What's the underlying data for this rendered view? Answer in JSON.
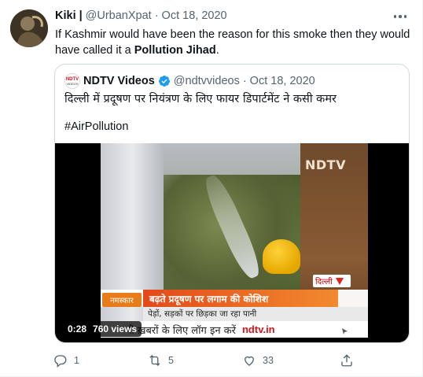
{
  "tweet": {
    "display_name": "Kiki",
    "separator": "|",
    "handle": "@UrbanXpat",
    "dot": "·",
    "date": "Oct 18, 2020",
    "text_prefix": "If Kashmir would have been the reason for this smoke then they would have called it a ",
    "text_bold": "Pollution Jihad",
    "text_suffix": "."
  },
  "quoted": {
    "avatar_text_1": "NDTV",
    "avatar_text_2": "VIDEOS",
    "display_name": "NDTV Videos",
    "handle": "@ndtvvideos",
    "dot": "·",
    "date": "Oct 18, 2020",
    "text": "दिल्ली में प्रदूषण पर नियंत्रण के लिए फायर डिपार्टमेंट ने कसी कमर",
    "hashtag": "#AirPollution"
  },
  "video": {
    "duration": "0:28",
    "views": "760 views",
    "logo": "NDTV",
    "location_tag": "दिल्ली",
    "namaskar": "नमस्कार",
    "headline": "बढ़ते प्रदूषण पर लगाम की कोशिश",
    "subline": "पेड़ों, सड़कों पर छिड़का जा रहा पानी",
    "bottom_ticker": "री ख़बरों के लिए लॉग इन करें",
    "bottom_site": "ndtv.in"
  },
  "actions": {
    "replies": "1",
    "retweets": "5",
    "likes": "33"
  },
  "colors": {
    "text": "#0f1419",
    "muted": "#536471",
    "verified": "#1d9bf0",
    "ndtv_red": "#d7141a"
  },
  "icons": [
    "more-icon",
    "verified-icon",
    "reply-icon",
    "retweet-icon",
    "like-icon",
    "share-icon"
  ]
}
